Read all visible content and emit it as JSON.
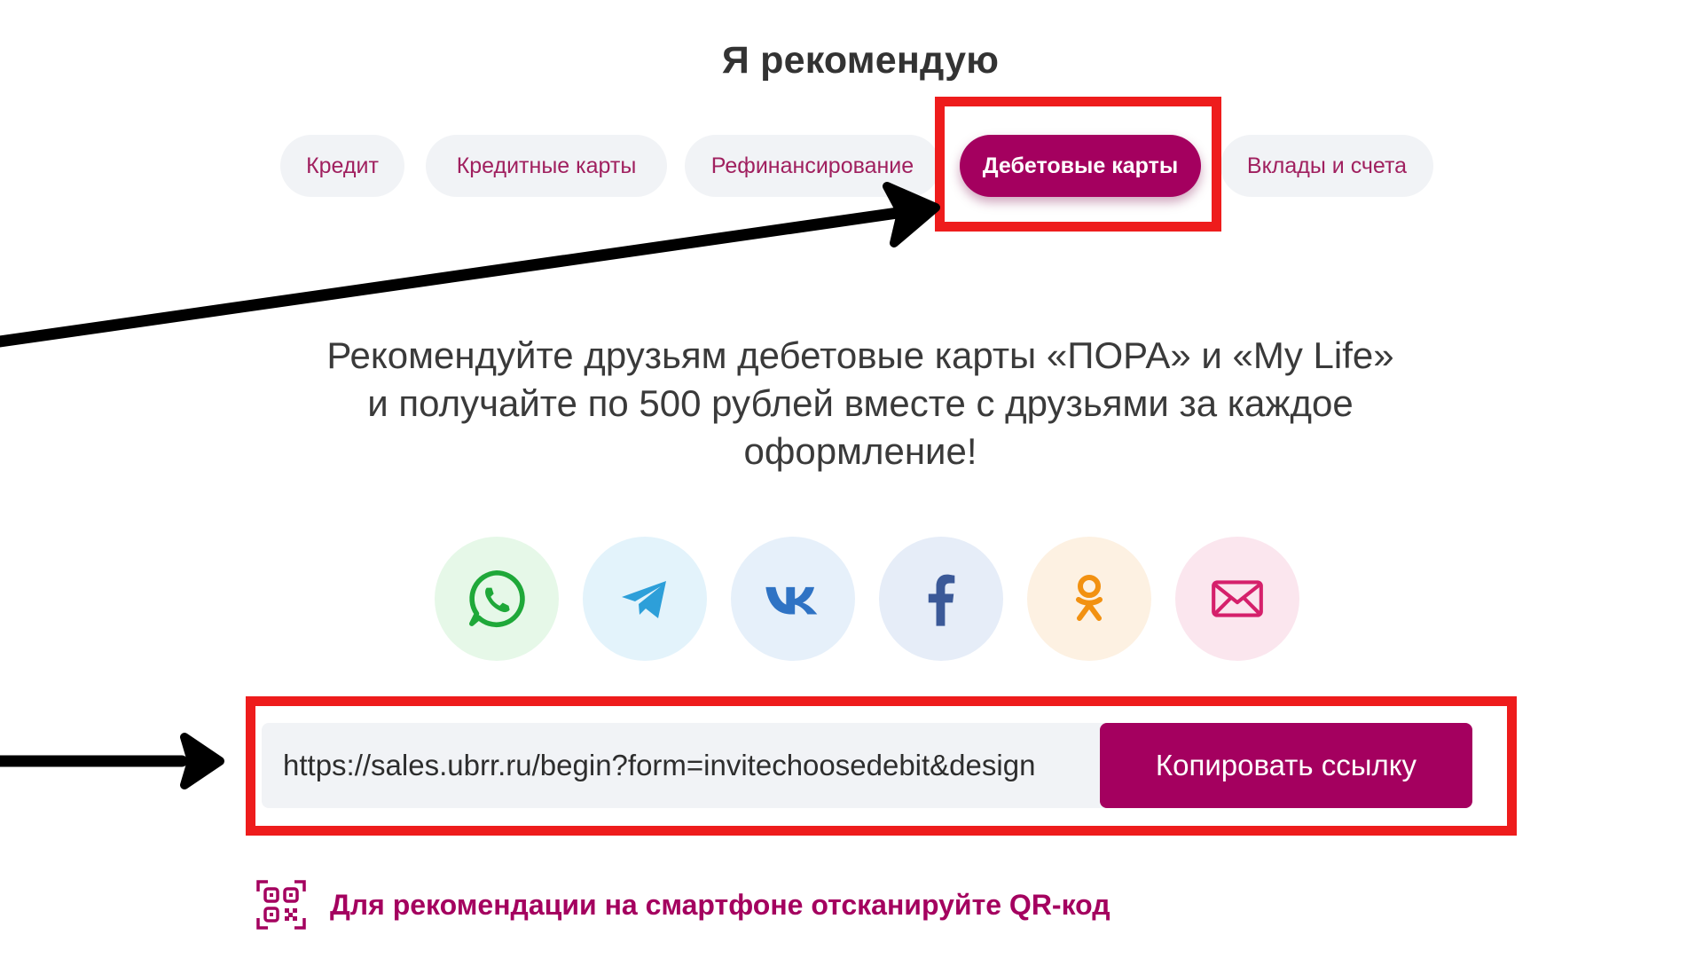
{
  "page": {
    "title": "Я рекомендую"
  },
  "tabs": [
    {
      "label": "Кредит",
      "active": false
    },
    {
      "label": "Кредитные карты",
      "active": false
    },
    {
      "label": "Рефинансирование",
      "active": false
    },
    {
      "label": "Дебетовые карты",
      "active": true
    },
    {
      "label": "Вклады и счета",
      "active": false
    }
  ],
  "promo": {
    "line1": "Рекомендуйте друзьям дебетовые карты «ПОРА» и «My Life»",
    "line2": "и получайте по 500 рублей вместе с друзьями за каждое",
    "line3": "оформление!"
  },
  "share": [
    {
      "icon": "whatsapp-icon",
      "bg": "#e6f8e8",
      "color": "#1fa839"
    },
    {
      "icon": "telegram-icon",
      "bg": "#e3f3fb",
      "color": "#2d9fd9"
    },
    {
      "icon": "vk-icon",
      "bg": "#e6f0fa",
      "color": "#2f73c4"
    },
    {
      "icon": "facebook-icon",
      "bg": "#e6edf8",
      "color": "#3b5998"
    },
    {
      "icon": "odnoklassniki-icon",
      "bg": "#fdf1e2",
      "color": "#f29111"
    },
    {
      "icon": "mail-icon",
      "bg": "#fbe6ee",
      "color": "#d5206b"
    }
  ],
  "link": {
    "value": "https://sales.ubrr.ru/begin?form=invitechoosedebit&design",
    "copy_label": "Копировать ссылку"
  },
  "qr": {
    "text": "Для рекомендации на смартфоне отсканируйте QR-код"
  },
  "colors": {
    "accent": "#a4005f",
    "tab_bg": "#f1f3f6",
    "highlight": "#ee1c1c",
    "arrow": "#000000"
  }
}
